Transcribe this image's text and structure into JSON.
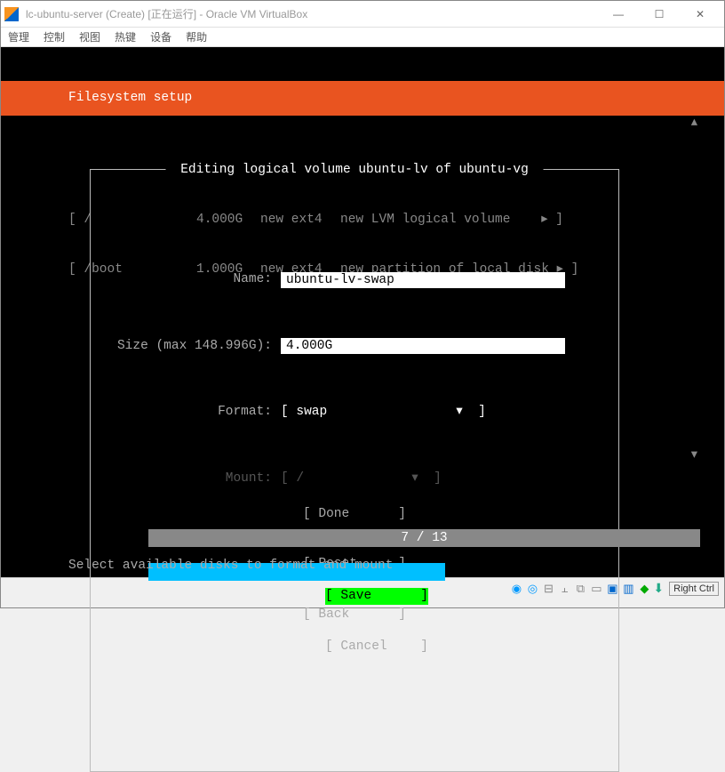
{
  "window": {
    "title": "lc-ubuntu-server (Create) [正在运行] - Oracle VM VirtualBox",
    "controls": {
      "min": "—",
      "max": "☐",
      "close": "✕"
    }
  },
  "menus": [
    "管理",
    "控制",
    "视图",
    "热键",
    "设备",
    "帮助"
  ],
  "header": "Filesystem setup",
  "fs_rows": [
    {
      "c1": "[ /",
      "c2": "4.000G",
      "c3": "new ext4",
      "c4": "new LVM logical volume",
      "arrow": "▸ ]"
    },
    {
      "c1": "[ /boot",
      "c2": "1.000G",
      "c3": "new ext4",
      "c4": "new partition of local disk",
      "arrow": "▸ ]"
    }
  ],
  "dialog": {
    "title": " Editing logical volume ubuntu-lv of ubuntu-vg ",
    "name_label": "Name:",
    "name_value": "ubuntu-lv-swap",
    "size_label": "Size (max 148.996G):",
    "size_value": "4.000G",
    "format_label": "Format:",
    "format_value": "swap",
    "mount_label": "Mount:",
    "mount_value": "/",
    "save": "Save",
    "cancel": "Cancel"
  },
  "bottom_btns": [
    "Done",
    "Reset",
    "Back"
  ],
  "progress": {
    "text": "7 / 13"
  },
  "hint": "Select available disks to format and mount",
  "statusbar": {
    "host_key": "Right Ctrl"
  }
}
